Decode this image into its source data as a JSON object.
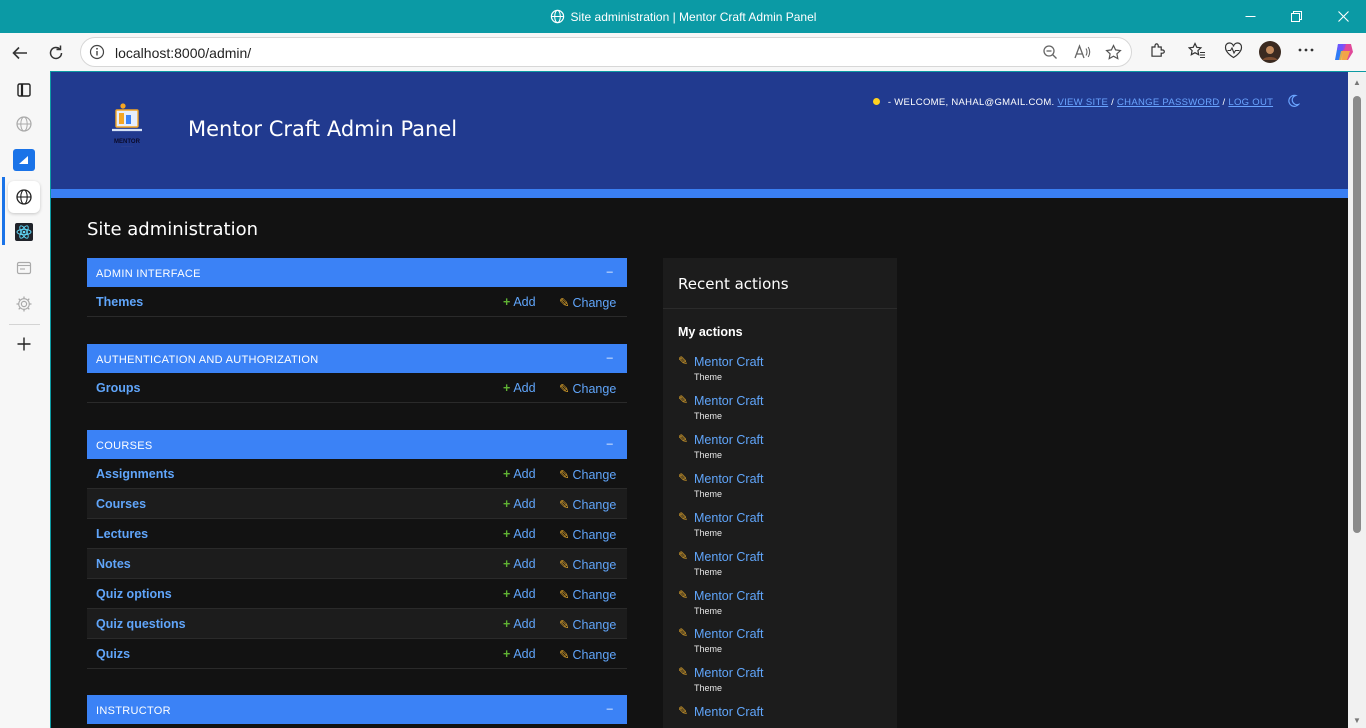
{
  "window": {
    "title": "Site administration | Mentor Craft Admin Panel"
  },
  "browser": {
    "url": "localhost:8000/admin/"
  },
  "header": {
    "branding": "Mentor Craft Admin Panel",
    "logo_text": "MENTOR",
    "welcome": "- WELCOME, ",
    "user": "NAHAL@GMAIL.COM.",
    "view_site": "VIEW SITE",
    "change_password": "CHANGE PASSWORD",
    "log_out": "LOG OUT",
    "sep": " / "
  },
  "content": {
    "title": "Site administration",
    "add_label": "Add",
    "change_label": "Change",
    "toggle": "–"
  },
  "modules": [
    {
      "caption": "ADMIN INTERFACE",
      "models": [
        "Themes"
      ]
    },
    {
      "caption": "AUTHENTICATION AND AUTHORIZATION",
      "models": [
        "Groups"
      ]
    },
    {
      "caption": "COURSES",
      "models": [
        "Assignments",
        "Courses",
        "Lectures",
        "Notes",
        "Quiz options",
        "Quiz questions",
        "Quizs"
      ]
    },
    {
      "caption": "INSTRUCTOR",
      "models": []
    }
  ],
  "recent_actions": {
    "title": "Recent actions",
    "subtitle": "My actions",
    "items": [
      {
        "name": "Mentor Craft",
        "type": "Theme"
      },
      {
        "name": "Mentor Craft",
        "type": "Theme"
      },
      {
        "name": "Mentor Craft",
        "type": "Theme"
      },
      {
        "name": "Mentor Craft",
        "type": "Theme"
      },
      {
        "name": "Mentor Craft",
        "type": "Theme"
      },
      {
        "name": "Mentor Craft",
        "type": "Theme"
      },
      {
        "name": "Mentor Craft",
        "type": "Theme"
      },
      {
        "name": "Mentor Craft",
        "type": "Theme"
      },
      {
        "name": "Mentor Craft",
        "type": "Theme"
      },
      {
        "name": "Mentor Craft",
        "type": ""
      }
    ]
  },
  "colors": {
    "header_bg": "#213a8f",
    "module_head": "#3b82f6",
    "link": "#60a5fa",
    "titlebar": "#0b9aa5"
  }
}
